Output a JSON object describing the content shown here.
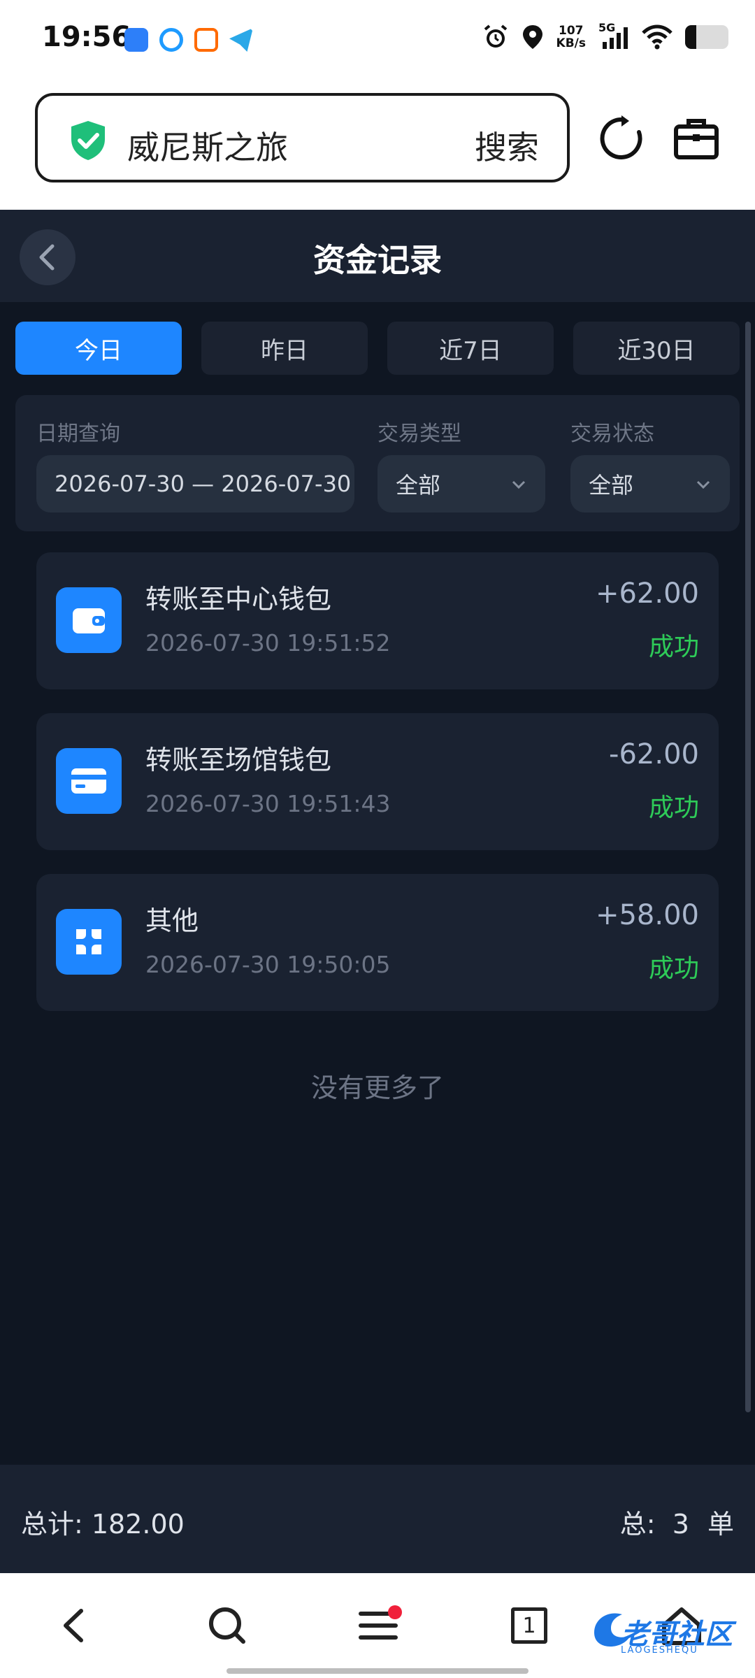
{
  "status_bar": {
    "time": "19:56",
    "net_speed_value": "107",
    "net_speed_unit": "KB/s",
    "network": "5G",
    "battery_level": 0.25
  },
  "browser": {
    "url_text": "威尼斯之旅",
    "search_label": "搜索"
  },
  "header": {
    "title": "资金记录"
  },
  "tabs": [
    {
      "label": "今日",
      "active": true
    },
    {
      "label": "昨日",
      "active": false
    },
    {
      "label": "近7日",
      "active": false
    },
    {
      "label": "近30日",
      "active": false
    }
  ],
  "filter": {
    "date_label": "日期查询",
    "date_range": "2026-07-30 — 2026-07-30",
    "type_label": "交易类型",
    "type_value": "全部",
    "status_label": "交易状态",
    "status_value": "全部"
  },
  "records": [
    {
      "title": "转账至中心钱包",
      "time": "2026-07-30 19:51:52",
      "amount": "+62.00",
      "status": "成功",
      "icon": "wallet-icon"
    },
    {
      "title": "转账至场馆钱包",
      "time": "2026-07-30 19:51:43",
      "amount": "-62.00",
      "status": "成功",
      "icon": "card-icon"
    },
    {
      "title": "其他",
      "time": "2026-07-30 19:50:05",
      "amount": "+58.00",
      "status": "成功",
      "icon": "grid-icon"
    }
  ],
  "no_more": "没有更多了",
  "summary": {
    "total": "总计: 182.00",
    "count_prefix": "总:",
    "count": "3",
    "count_unit": "单"
  },
  "bottom_nav": {
    "tab_count": "1"
  },
  "watermark": {
    "text": "老哥社区",
    "sub": "LAOGESHEQU"
  },
  "colors": {
    "accent": "#1e86ff",
    "success": "#2ecb58",
    "background": "#0f1622",
    "card": "#1a2231"
  }
}
